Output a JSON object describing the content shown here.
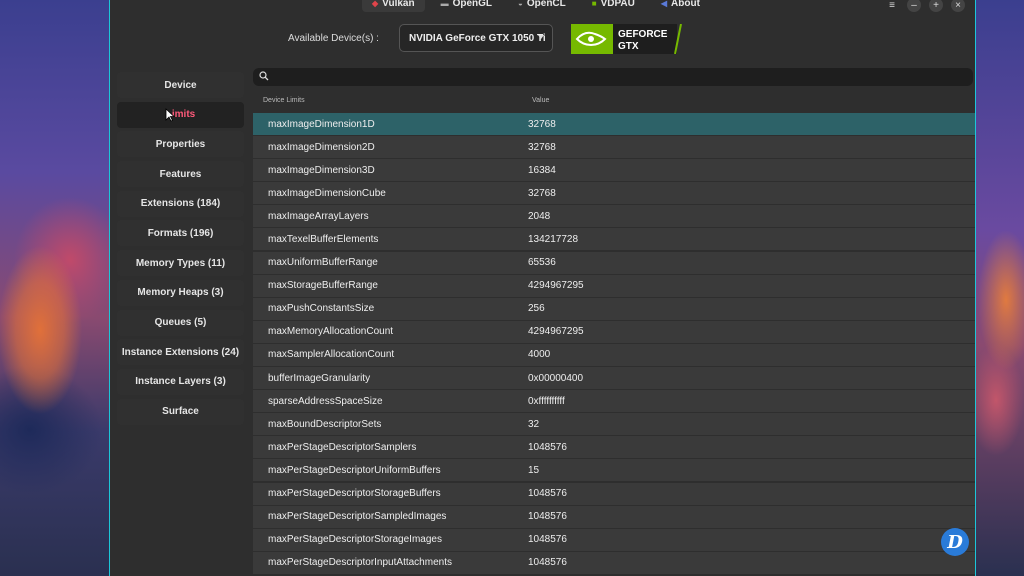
{
  "tabs": [
    {
      "label": "Vulkan",
      "icon": "vulkan-icon"
    },
    {
      "label": "OpenGL",
      "icon": "opengl-icon"
    },
    {
      "label": "OpenCL",
      "icon": "opencl-icon"
    },
    {
      "label": "VDPAU",
      "icon": "nvidia-icon"
    },
    {
      "label": "About",
      "icon": "about-icon"
    }
  ],
  "device": {
    "label": "Available Device(s) :",
    "selected": "NVIDIA GeForce GTX 1050 Ti",
    "logo_text_1": "GEFORCE",
    "logo_text_2": "GTX"
  },
  "sidebar": {
    "items": [
      {
        "label": "Device"
      },
      {
        "label": "Limits"
      },
      {
        "label": "Properties"
      },
      {
        "label": "Features"
      },
      {
        "label": "Extensions (184)"
      },
      {
        "label": "Formats (196)"
      },
      {
        "label": "Memory Types (11)"
      },
      {
        "label": "Memory Heaps (3)"
      },
      {
        "label": "Queues (5)"
      },
      {
        "label": "Instance Extensions (24)"
      },
      {
        "label": "Instance Layers (3)"
      },
      {
        "label": "Surface"
      }
    ]
  },
  "table": {
    "headers": [
      "Device Limits",
      "Value"
    ],
    "rows": [
      [
        "maxImageDimension1D",
        "32768"
      ],
      [
        "maxImageDimension2D",
        "32768"
      ],
      [
        "maxImageDimension3D",
        "16384"
      ],
      [
        "maxImageDimensionCube",
        "32768"
      ],
      [
        "maxImageArrayLayers",
        "2048"
      ],
      [
        "maxTexelBufferElements",
        "134217728"
      ],
      [
        "maxUniformBufferRange",
        "65536"
      ],
      [
        "maxStorageBufferRange",
        "4294967295"
      ],
      [
        "maxPushConstantsSize",
        "256"
      ],
      [
        "maxMemoryAllocationCount",
        "4294967295"
      ],
      [
        "maxSamplerAllocationCount",
        "4000"
      ],
      [
        "bufferImageGranularity",
        "0x00000400"
      ],
      [
        "sparseAddressSpaceSize",
        "0xffffffffff"
      ],
      [
        "maxBoundDescriptorSets",
        "32"
      ],
      [
        "maxPerStageDescriptorSamplers",
        "1048576"
      ],
      [
        "maxPerStageDescriptorUniformBuffers",
        "15"
      ],
      [
        "maxPerStageDescriptorStorageBuffers",
        "1048576"
      ],
      [
        "maxPerStageDescriptorSampledImages",
        "1048576"
      ],
      [
        "maxPerStageDescriptorStorageImages",
        "1048576"
      ],
      [
        "maxPerStageDescriptorInputAttachments",
        "1048576"
      ]
    ]
  },
  "window_controls": [
    "menu-icon",
    "minimize-icon",
    "maximize-icon",
    "close-icon"
  ],
  "badge": {
    "letter": "D"
  },
  "colors": {
    "accent": "#1cc6d8",
    "selected_row": "#2d6268",
    "selected_nav_text": "#ff5a7a",
    "nvidia_green": "#76b900"
  }
}
